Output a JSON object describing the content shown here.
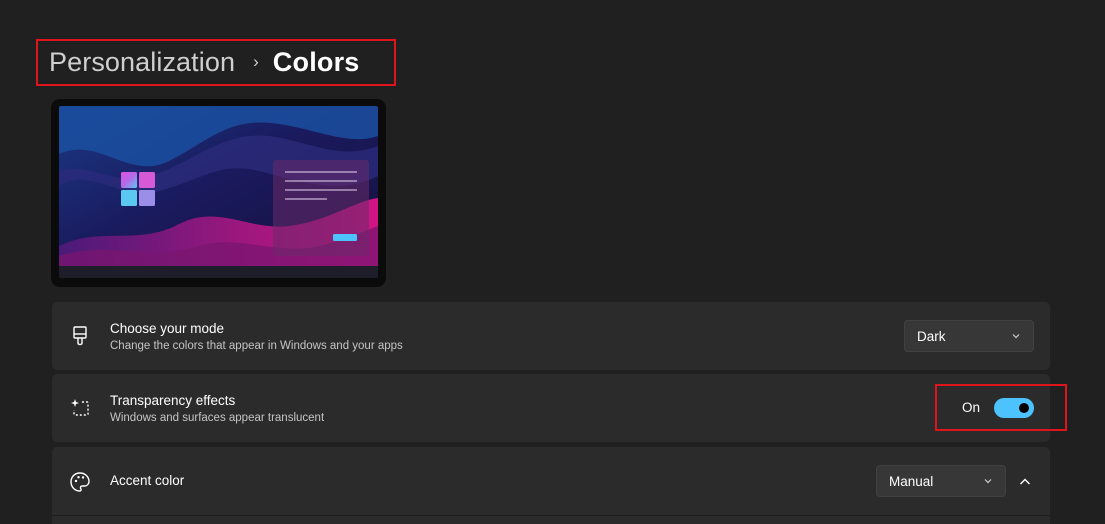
{
  "breadcrumb": {
    "parent": "Personalization",
    "separator": "›",
    "current": "Colors"
  },
  "preview": {
    "icon": "windows-logo-icon",
    "window_lines": 4,
    "accent_hex": "#4cc2ff"
  },
  "settings": {
    "mode": {
      "title": "Choose your mode",
      "description": "Change the colors that appear in Windows and your apps",
      "value": "Dark",
      "icon": "paintbrush-icon"
    },
    "transparency": {
      "title": "Transparency effects",
      "description": "Windows and surfaces appear translucent",
      "state_label": "On",
      "enabled": true,
      "icon": "transparency-icon"
    },
    "accent": {
      "title": "Accent color",
      "value": "Manual",
      "icon": "palette-icon",
      "expanded": true
    }
  },
  "colors": {
    "background": "#202020",
    "card": "#2b2b2b",
    "accent": "#4cc2ff",
    "highlight_border": "#e0141b"
  }
}
